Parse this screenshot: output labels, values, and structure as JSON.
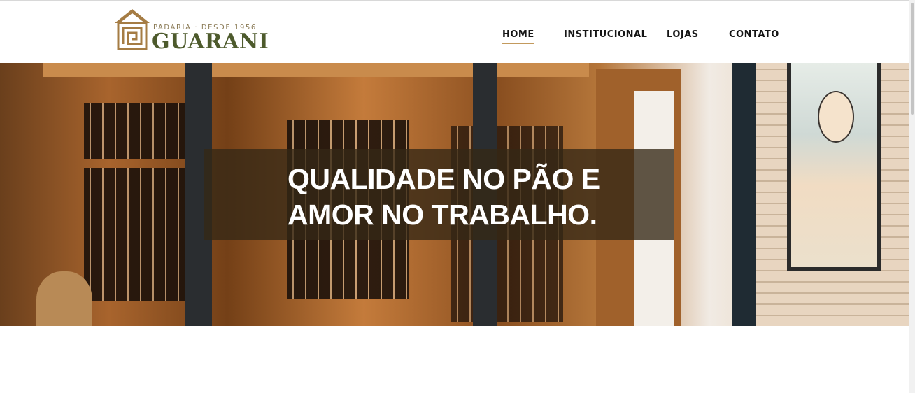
{
  "logo": {
    "tagline": "PADARIA · DESDE 1956",
    "name": "GUARANI",
    "icon": "greek-key-square-icon",
    "color_tagline": "#8a7a55",
    "color_name": "#4d5a2c",
    "color_mark": "#a57c44"
  },
  "nav": {
    "items": [
      {
        "label": "HOME",
        "active": true
      },
      {
        "label": "INSTITUCIONAL",
        "active": false
      },
      {
        "label": "LOJAS",
        "active": false
      },
      {
        "label": "CONTATO",
        "active": false
      }
    ],
    "active_underline_color": "#c39a5d"
  },
  "hero": {
    "headline_line1": "QUALIDADE NO PÃO E",
    "headline_line2": "AMOR NO TRABALHO.",
    "overlay_color": "#342816"
  }
}
